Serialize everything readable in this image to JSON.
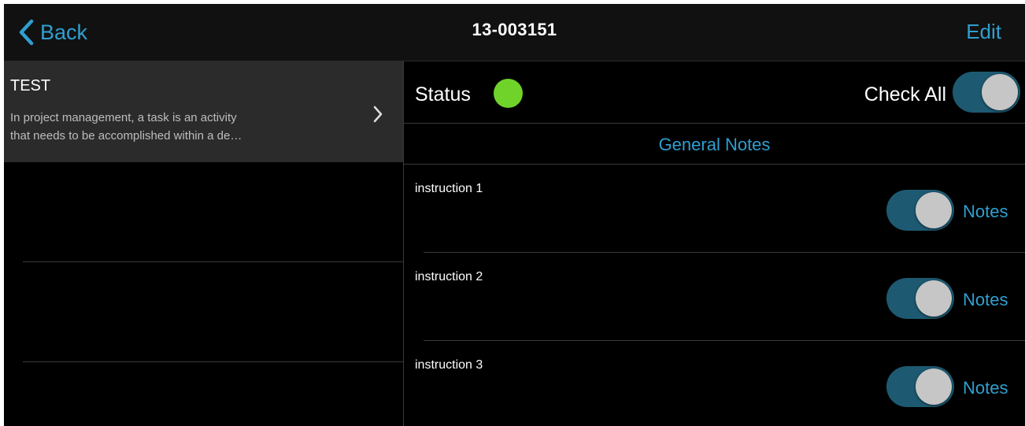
{
  "nav": {
    "back_label": "Back",
    "title": "13-003151",
    "edit_label": "Edit"
  },
  "task": {
    "title": "TEST",
    "description_line1": "In project management, a task is an activity",
    "description_line2": "that needs to be accomplished within a de…"
  },
  "status": {
    "label": "Status",
    "color": "#6fd32a"
  },
  "check_all": {
    "label": "Check All",
    "on": true
  },
  "general_notes_label": "General Notes",
  "instructions": [
    {
      "label": "instruction 1",
      "notes_label": "Notes",
      "on": true
    },
    {
      "label": "instruction 2",
      "notes_label": "Notes",
      "on": true
    },
    {
      "label": "instruction 3",
      "notes_label": "Notes",
      "on": true
    }
  ],
  "colors": {
    "accent": "#2f9fd0",
    "toggle_track": "#1d5a72",
    "cell_bg": "#2b2b2b"
  }
}
